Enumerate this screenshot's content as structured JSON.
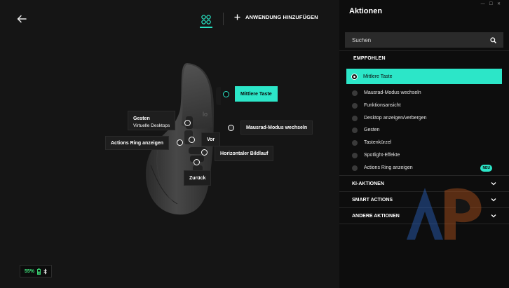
{
  "header": {
    "add_app_label": "ANWENDUNG HINZUFÜGEN"
  },
  "callouts": {
    "middle_button": "Mittlere Taste",
    "gestures_title": "Gesten",
    "gestures_sub": "Virtuelle Desktops",
    "wheel_mode": "Mausrad-Modus wechseln",
    "actions_ring": "Actions Ring anzeigen",
    "forward": "Vor",
    "horizontal_scroll": "Horizontaler Bildlauf",
    "back": "Zurück"
  },
  "battery": {
    "level": "55%"
  },
  "panel": {
    "title": "Aktionen",
    "search_placeholder": "Suchen",
    "recommended_label": "EMPFOHLEN",
    "items": [
      {
        "label": "Mittlere Taste",
        "active": true
      },
      {
        "label": "Mausrad-Modus wechseln"
      },
      {
        "label": "Funktionsansicht"
      },
      {
        "label": "Desktop anzeigen/verbergen"
      },
      {
        "label": "Gesten"
      },
      {
        "label": "Tastenkürzel"
      },
      {
        "label": "Spotlight-Effekte"
      },
      {
        "label": "Actions Ring anzeigen",
        "badge": "NEU"
      }
    ],
    "sections": [
      {
        "label": "KI-AKTIONEN"
      },
      {
        "label": "SMART ACTIONS"
      },
      {
        "label": "ANDERE AKTIONEN"
      }
    ]
  },
  "colors": {
    "accent": "#2ce6c8",
    "battery_green": "#3ee07a",
    "background": "#151515",
    "panel_background": "#0d0d0d"
  }
}
